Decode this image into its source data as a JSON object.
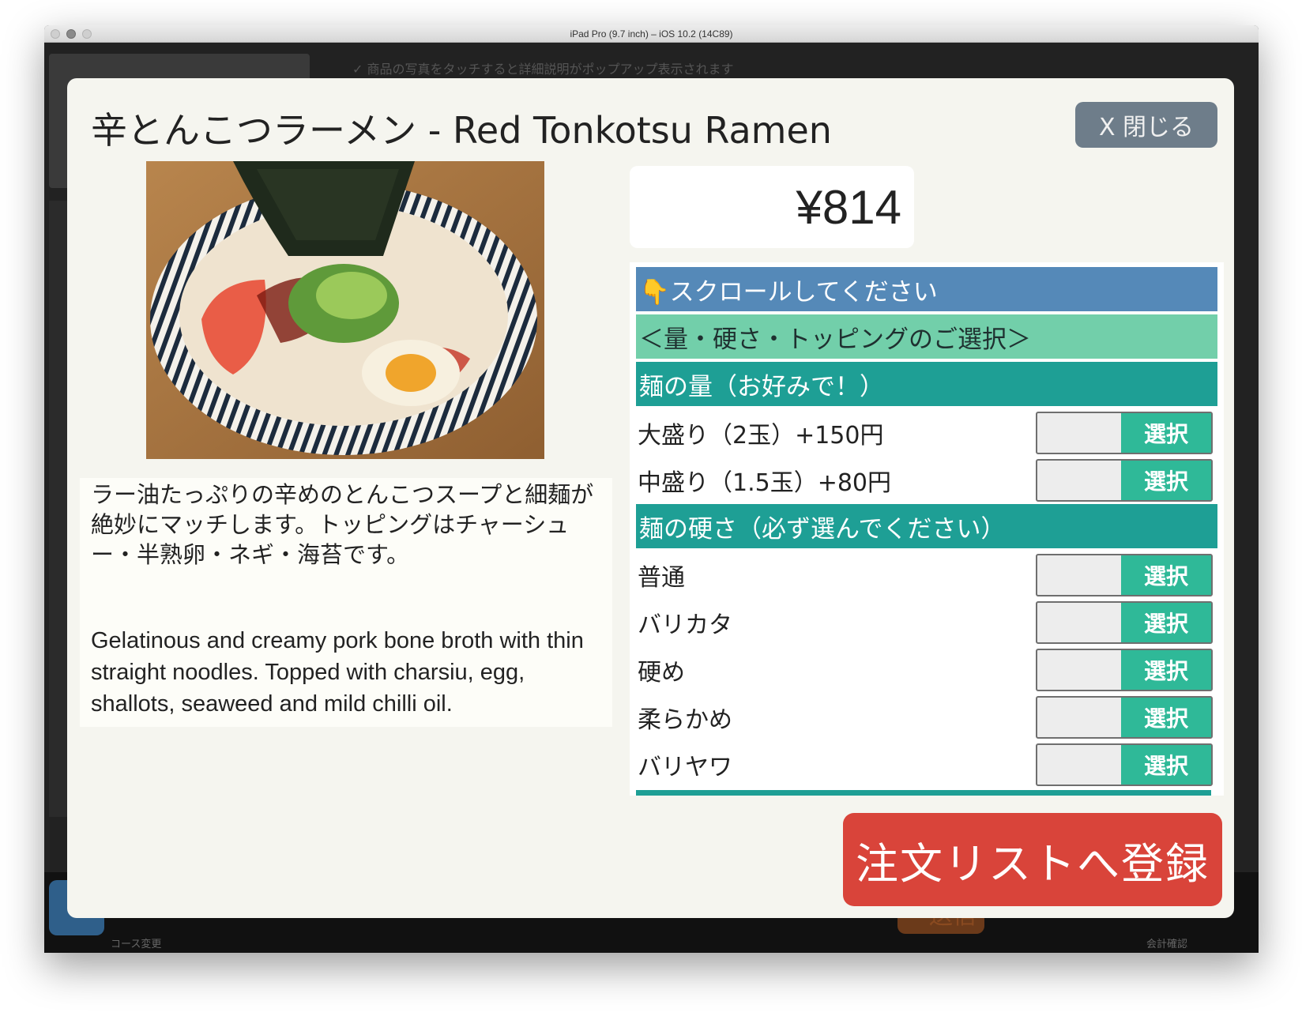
{
  "window": {
    "title": "iPad Pro (9.7 inch) – iOS 10.2 (14C89)"
  },
  "background": {
    "hint": "✓ 商品の写真をタッチすると詳細説明がポップアップ表示されます",
    "course_change_label": "コース変更",
    "send_label": "送信",
    "checkout_label": "会計確認"
  },
  "modal": {
    "title": "辛とんこつラーメン - Red Tonkotsu Ramen",
    "close_label": "X 閉じる",
    "price": "¥814",
    "description_ja": "ラー油たっぷりの辛めのとんこつスープと細麺が絶妙にマッチします。トッピングはチャーシュー・半熟卵・ネギ・海苔です。",
    "description_en": "Gelatinous and creamy pork bone broth with thin straight noodles. Topped with charsiu, egg, shallots, seaweed and mild chilli oil.",
    "scroll_hint": "👇スクロールしてください",
    "options_title": "＜量・硬さ・トッピングのご選択＞",
    "sections": [
      {
        "title": "麺の量（お好みで！）",
        "items": [
          {
            "label": "大盛り（2玉）+150円",
            "button": "選択"
          },
          {
            "label": "中盛り（1.5玉）+80円",
            "button": "選択"
          }
        ]
      },
      {
        "title": "麺の硬さ（必ず選んでください）",
        "items": [
          {
            "label": "普通",
            "button": "選択"
          },
          {
            "label": "バリカタ",
            "button": "選択"
          },
          {
            "label": "硬め",
            "button": "選択"
          },
          {
            "label": "柔らかめ",
            "button": "選択"
          },
          {
            "label": "バリヤワ",
            "button": "選択"
          }
        ]
      }
    ],
    "order_button": "注文リストへ登録"
  },
  "colors": {
    "close_button": "#6e7d8a",
    "scroll_header": "#5589b8",
    "options_header": "#72cfaa",
    "section_header": "#1e9f95",
    "select_button": "#2fb998",
    "order_button": "#d9443a"
  }
}
